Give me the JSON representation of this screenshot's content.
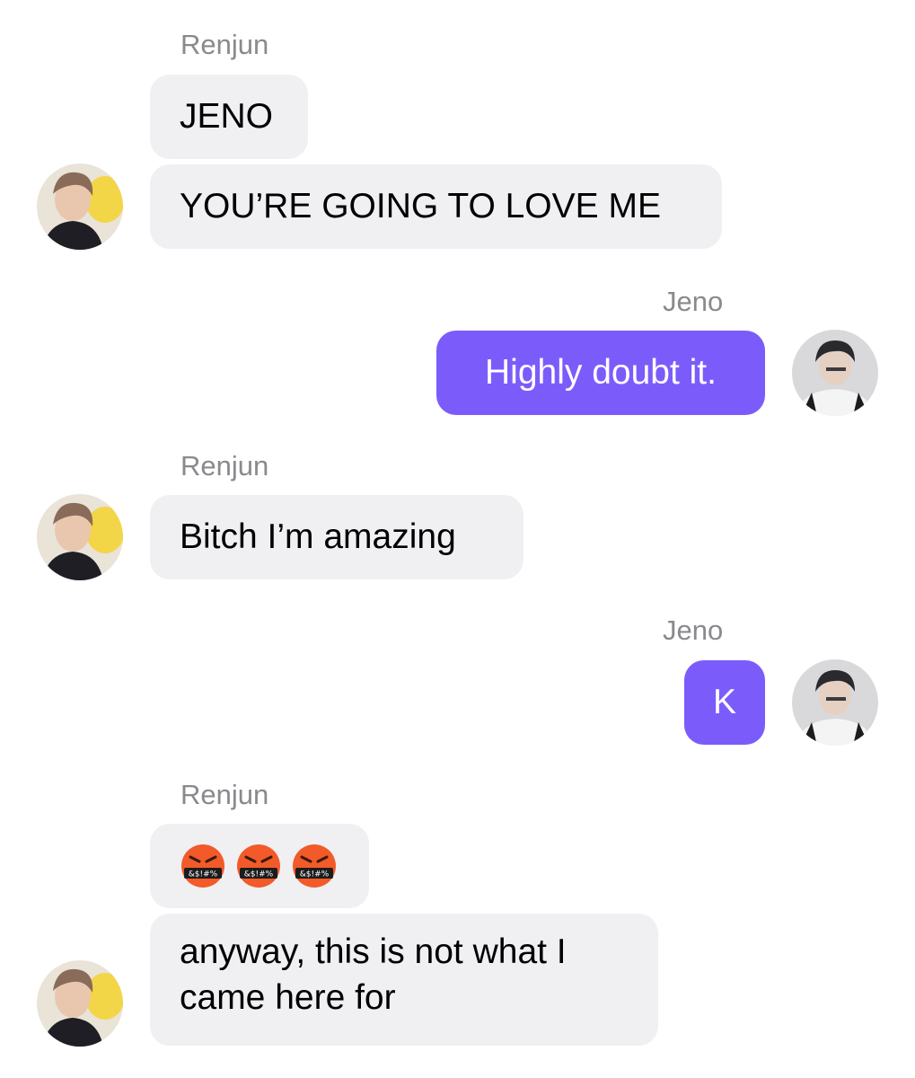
{
  "messages": [
    {
      "sender": "Renjun"
    },
    {
      "text": "JENO"
    },
    {
      "text": "YOU’RE GOING TO LOVE ME"
    },
    {
      "sender": "Jeno"
    },
    {
      "text": "Highly doubt it."
    },
    {
      "sender": "Renjun"
    },
    {
      "text": "Bitch I’m amazing"
    },
    {
      "sender": "Jeno"
    },
    {
      "text": "K"
    },
    {
      "sender": "Renjun"
    },
    {
      "emojis": [
        "cursing-face-emoji",
        "cursing-face-emoji",
        "cursing-face-emoji"
      ],
      "emoji_glyph_text": "&$!#%"
    },
    {
      "text": "anyway, this is not what I came here for"
    }
  ],
  "colors": {
    "sent_bubble": "#7b5cfb",
    "received_bubble": "#f0f0f3",
    "sender_name": "#8a8a8e",
    "background": "#ffffff"
  }
}
